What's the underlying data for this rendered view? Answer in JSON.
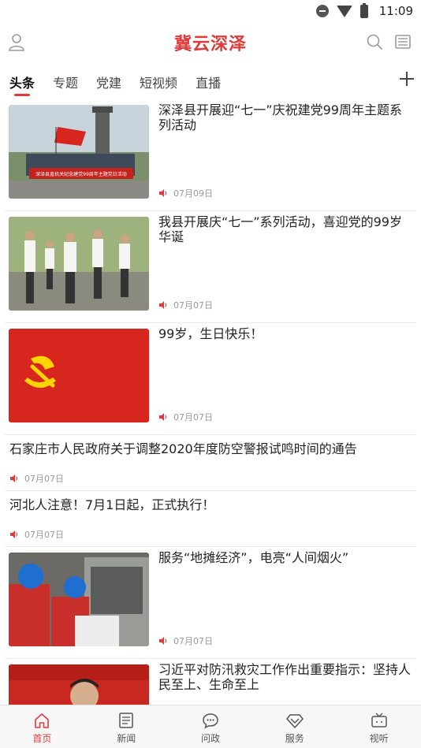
{
  "status_bar": {
    "time": "11:09"
  },
  "header": {
    "title": "冀云深泽"
  },
  "tabs": [
    {
      "label": "头条",
      "active": true
    },
    {
      "label": "专题"
    },
    {
      "label": "党建"
    },
    {
      "label": "短视频"
    },
    {
      "label": "直播"
    }
  ],
  "news": [
    {
      "title": "深泽县开展迎“七一”庆祝建党99周年主题系列活动",
      "date": "07月09日",
      "banner_text": "深泽县直机关纪念建党99周年主题党日活动",
      "thumb": "group-photo-flag"
    },
    {
      "title": "我县开展庆“七一”系列活动，喜迎党的99岁华诞",
      "date": "07月07日",
      "thumb": "oath-ceremony"
    },
    {
      "title": "99岁，生日快乐！",
      "date": "07月07日",
      "thumb": "party-flag"
    },
    {
      "title": "石家庄市人民政府关于调整2020年度防空警报试鸣时间的通告",
      "date": "07月07日"
    },
    {
      "title": "河北人注意！7月1日起，正式执行！",
      "date": "07月07日"
    },
    {
      "title": "服务“地摊经济”，电亮“人间烟火”",
      "date": "07月07日",
      "thumb": "electricians-working"
    },
    {
      "title": "习近平对防汛救灾工作作出重要指示：坚持人民至上、生命至上",
      "date": "",
      "thumb": "portrait"
    }
  ],
  "bottom_nav": [
    {
      "label": "首页",
      "icon": "home-icon",
      "active": true
    },
    {
      "label": "新闻",
      "icon": "news-icon"
    },
    {
      "label": "问政",
      "icon": "chat-icon"
    },
    {
      "label": "服务",
      "icon": "diamond-icon"
    },
    {
      "label": "视听",
      "icon": "tv-icon"
    }
  ],
  "colors": {
    "accent": "#e03a3a",
    "flag_red": "#d7261e",
    "flag_gold": "#ffd500"
  }
}
